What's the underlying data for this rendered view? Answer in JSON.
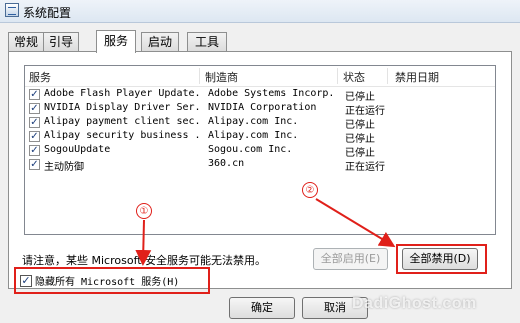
{
  "window": {
    "title": "系统配置"
  },
  "tabs": [
    {
      "label": "常规"
    },
    {
      "label": "引导"
    },
    {
      "label": "服务"
    },
    {
      "label": "启动"
    },
    {
      "label": "工具"
    }
  ],
  "columns": [
    "服务",
    "制造商",
    "状态",
    "禁用日期"
  ],
  "services": [
    {
      "checked": true,
      "name": "Adobe Flash Player Update...",
      "vendor": "Adobe Systems Incorp...",
      "status": "已停止"
    },
    {
      "checked": true,
      "name": "NVIDIA Display Driver Ser...",
      "vendor": "NVIDIA Corporation",
      "status": "正在运行"
    },
    {
      "checked": true,
      "name": "Alipay payment client sec...",
      "vendor": "Alipay.com Inc.",
      "status": "已停止"
    },
    {
      "checked": true,
      "name": "Alipay security business ...",
      "vendor": "Alipay.com Inc.",
      "status": "已停止"
    },
    {
      "checked": true,
      "name": "SogouUpdate",
      "vendor": "Sogou.com Inc.",
      "status": "已停止"
    },
    {
      "checked": true,
      "name": "主动防御",
      "vendor": "360.cn",
      "status": "正在运行"
    }
  ],
  "notice": "请注意，某些 Microsoft 安全服务可能无法禁用。",
  "buttons": {
    "enable_all": "全部启用(E)",
    "disable_all": "全部禁用(D)",
    "ok": "确定",
    "cancel": "取消"
  },
  "hide_ms": {
    "checked": true,
    "label": "隐藏所有 Microsoft 服务(H)"
  },
  "annotations": {
    "marker1": "①",
    "marker2": "②",
    "color": "#e0201a"
  },
  "watermark": "DadiGhost.com"
}
